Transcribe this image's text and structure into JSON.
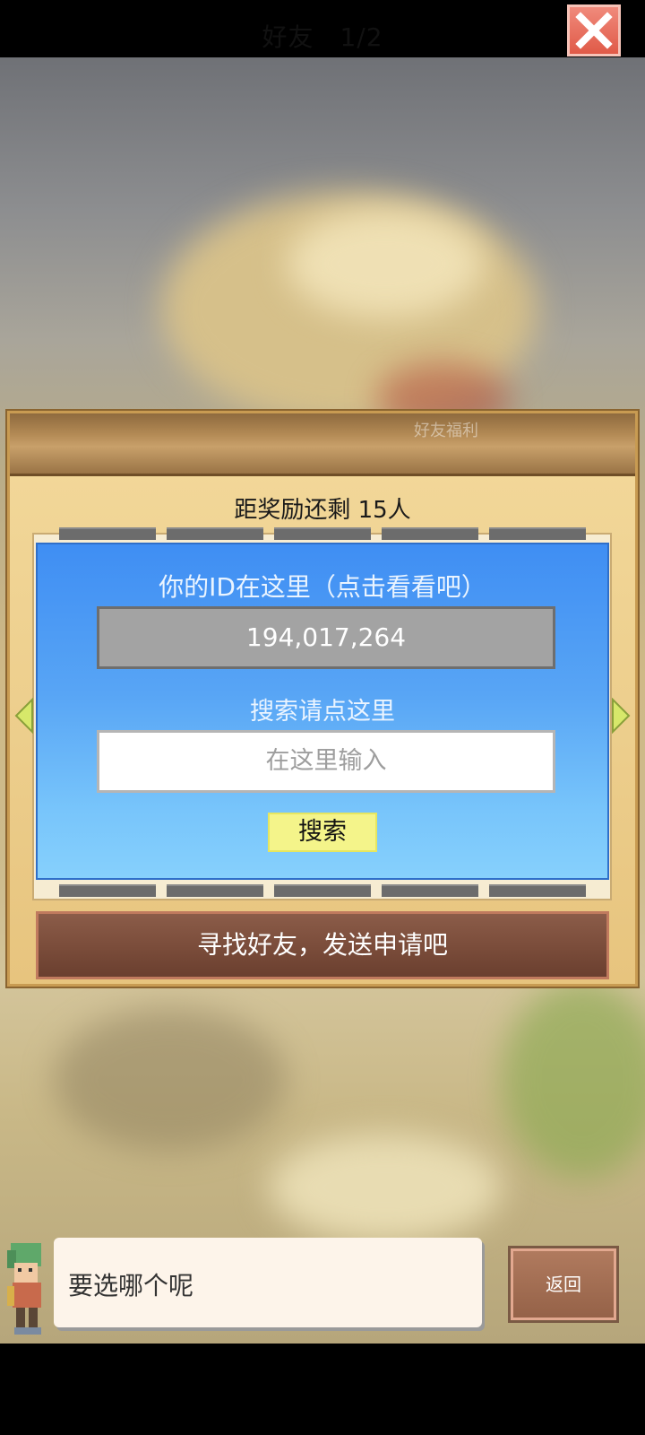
{
  "dialog": {
    "title": "好友　1/2",
    "faint_label": "好友福利",
    "reward_text": "距奖励还剩 15人",
    "close_icon": "close-icon"
  },
  "panel": {
    "id_label": "你的ID在这里（点击看看吧）",
    "id_value": "194,017,264",
    "search_label": "搜索请点这里",
    "search_placeholder": "在这里输入",
    "search_button": "搜索"
  },
  "find_friend_button": "寻找好友，发送申请吧",
  "speech": {
    "text": "要选哪个呢"
  },
  "back_button": "返回",
  "colors": {
    "panel_blue": "#3f8ef3",
    "search_button_yellow": "#f4f48a",
    "close_red": "#e05a48",
    "brown_button": "#7a4c3a"
  }
}
